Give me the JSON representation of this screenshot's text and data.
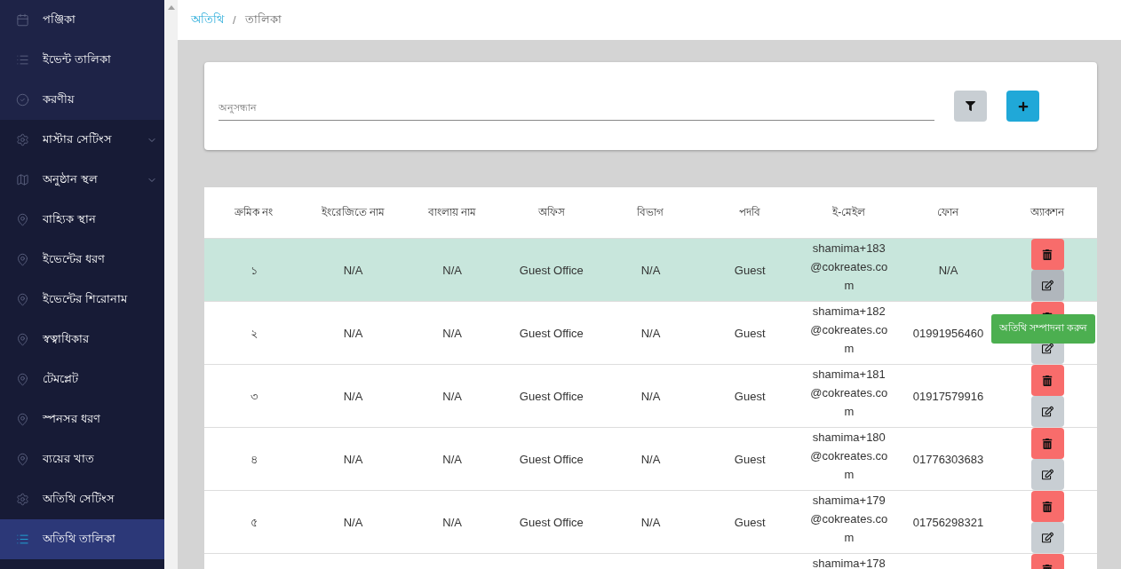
{
  "sidebar": {
    "sections": [
      {
        "kind": "primary",
        "items": [
          {
            "kind": "calendar",
            "label": "পঞ্জিকা",
            "expandable": false,
            "selected": false
          },
          {
            "kind": "list",
            "label": "ইভেন্ট তালিকা",
            "expandable": false,
            "selected": false
          },
          {
            "kind": "check",
            "label": "করণীয়",
            "expandable": false,
            "selected": false
          }
        ]
      },
      {
        "kind": "secondary",
        "items": [
          {
            "kind": "settings",
            "label": "মাস্টার সেটিংস",
            "expandable": true,
            "selected": false
          },
          {
            "kind": "map",
            "label": "অনুষ্ঠান স্থল",
            "expandable": true,
            "selected": false
          },
          {
            "kind": "place",
            "label": "বাহ্যিক স্থান",
            "expandable": false,
            "selected": false
          },
          {
            "kind": "place",
            "label": "ইভেন্টের ধরণ",
            "expandable": false,
            "selected": false
          },
          {
            "kind": "place",
            "label": "ইভেন্টের শিরোনাম",
            "expandable": false,
            "selected": false
          },
          {
            "kind": "place",
            "label": "স্বত্বাধিকার",
            "expandable": false,
            "selected": false
          },
          {
            "kind": "place",
            "label": "টেমপ্লেট",
            "expandable": false,
            "selected": false
          },
          {
            "kind": "place",
            "label": "স্পনসর ধরণ",
            "expandable": false,
            "selected": false
          },
          {
            "kind": "place",
            "label": "ব্যয়ের খাত",
            "expandable": false,
            "selected": false
          },
          {
            "kind": "settings",
            "label": "অতিথি সেটিংস",
            "expandable": false,
            "selected": false
          },
          {
            "kind": "list",
            "label": "অতিথি তালিকা",
            "expandable": false,
            "selected": true
          }
        ]
      }
    ]
  },
  "breadcrumb": [
    "অতিথি",
    "তালিকা"
  ],
  "breadcrumb_separator": "/",
  "search": {
    "placeholder": "অনুসন্ধান"
  },
  "table": {
    "columns": [
      "ক্রমিক নং",
      "ইংরেজিতে নাম",
      "বাংলায় নাম",
      "অফিস",
      "বিভাগ",
      "পদবি",
      "ই-মেইল",
      "ফোন",
      "অ্যাকশন"
    ],
    "rows": [
      {
        "highlighted": true,
        "cells": [
          "১",
          "N/A",
          "N/A",
          "Guest Office",
          "N/A",
          "Guest",
          "shamima+183@cokreates.com",
          "N/A"
        ]
      },
      {
        "highlighted": false,
        "cells": [
          "২",
          "N/A",
          "N/A",
          "Guest Office",
          "N/A",
          "Guest",
          "shamima+182@cokreates.com",
          "01991956460"
        ],
        "tooltip": "অতিথি সম্পাদনা করুন"
      },
      {
        "highlighted": false,
        "cells": [
          "৩",
          "N/A",
          "N/A",
          "Guest Office",
          "N/A",
          "Guest",
          "shamima+181@cokreates.com",
          "01917579916"
        ]
      },
      {
        "highlighted": false,
        "cells": [
          "৪",
          "N/A",
          "N/A",
          "Guest Office",
          "N/A",
          "Guest",
          "shamima+180@cokreates.com",
          "01776303683"
        ]
      },
      {
        "highlighted": false,
        "cells": [
          "৫",
          "N/A",
          "N/A",
          "Guest Office",
          "N/A",
          "Guest",
          "shamima+179@cokreates.com",
          "01756298321"
        ]
      },
      {
        "highlighted": false,
        "cells": [
          null,
          null,
          null,
          null,
          null,
          null,
          "shamima+178",
          null
        ]
      }
    ]
  }
}
